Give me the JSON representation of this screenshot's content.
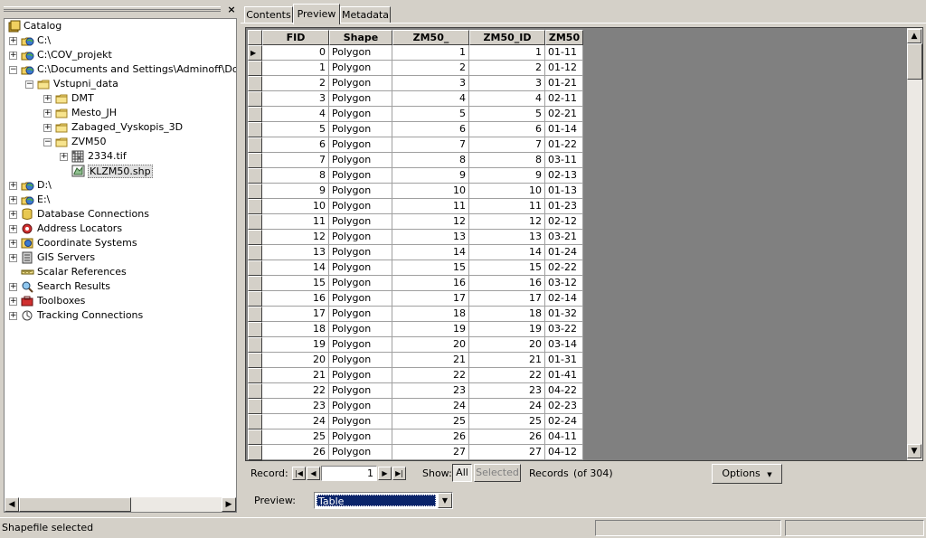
{
  "catalog": {
    "close_glyph": "×",
    "nodes": [
      {
        "label": "Catalog",
        "icon": "catalog-icon",
        "level": 0,
        "expander": ""
      },
      {
        "label": "C:\\",
        "icon": "folder-connection-icon",
        "level": 1,
        "expander": "+"
      },
      {
        "label": "C:\\COV_projekt",
        "icon": "folder-connection-icon",
        "level": 1,
        "expander": "+"
      },
      {
        "label": "C:\\Documents and Settings\\Adminoff\\Dokum",
        "icon": "folder-connection-icon",
        "level": 1,
        "expander": "−"
      },
      {
        "label": "Vstupni_data",
        "icon": "folder-icon",
        "level": 2,
        "expander": "−"
      },
      {
        "label": "DMT",
        "icon": "folder-icon",
        "level": 3,
        "expander": "+"
      },
      {
        "label": "Mesto_JH",
        "icon": "folder-icon",
        "level": 3,
        "expander": "+"
      },
      {
        "label": "Zabaged_Vyskopis_3D",
        "icon": "folder-icon",
        "level": 3,
        "expander": "+"
      },
      {
        "label": "ZVM50",
        "icon": "folder-icon",
        "level": 3,
        "expander": "−"
      },
      {
        "label": "2334.tif",
        "icon": "raster-icon",
        "level": 4,
        "expander": "+"
      },
      {
        "label": "KLZM50.shp",
        "icon": "shapefile-icon",
        "level": 4,
        "expander": "",
        "selected": true
      },
      {
        "label": "D:\\",
        "icon": "folder-connection-icon",
        "level": 1,
        "expander": "+"
      },
      {
        "label": "E:\\",
        "icon": "folder-connection-icon",
        "level": 1,
        "expander": "+"
      },
      {
        "label": "Database Connections",
        "icon": "database-connections-icon",
        "level": 1,
        "expander": "+"
      },
      {
        "label": "Address Locators",
        "icon": "address-locators-icon",
        "level": 1,
        "expander": "+"
      },
      {
        "label": "Coordinate Systems",
        "icon": "coordinate-systems-icon",
        "level": 1,
        "expander": "+"
      },
      {
        "label": "GIS Servers",
        "icon": "gis-servers-icon",
        "level": 1,
        "expander": "+"
      },
      {
        "label": "Scalar References",
        "icon": "scalar-references-icon",
        "level": 1,
        "expander": ""
      },
      {
        "label": "Search Results",
        "icon": "search-results-icon",
        "level": 1,
        "expander": "+"
      },
      {
        "label": "Toolboxes",
        "icon": "toolboxes-icon",
        "level": 1,
        "expander": "+"
      },
      {
        "label": "Tracking Connections",
        "icon": "tracking-connections-icon",
        "level": 1,
        "expander": "+"
      }
    ]
  },
  "tabs": [
    "Contents",
    "Preview",
    "Metadata"
  ],
  "active_tab": 1,
  "table": {
    "columns": [
      "FID",
      "Shape",
      "ZM50_",
      "ZM50_ID",
      "ZM50"
    ],
    "rows": [
      [
        "0",
        "Polygon",
        "1",
        "1",
        "01-11"
      ],
      [
        "1",
        "Polygon",
        "2",
        "2",
        "01-12"
      ],
      [
        "2",
        "Polygon",
        "3",
        "3",
        "01-21"
      ],
      [
        "3",
        "Polygon",
        "4",
        "4",
        "02-11"
      ],
      [
        "4",
        "Polygon",
        "5",
        "5",
        "02-21"
      ],
      [
        "5",
        "Polygon",
        "6",
        "6",
        "01-14"
      ],
      [
        "6",
        "Polygon",
        "7",
        "7",
        "01-22"
      ],
      [
        "7",
        "Polygon",
        "8",
        "8",
        "03-11"
      ],
      [
        "8",
        "Polygon",
        "9",
        "9",
        "02-13"
      ],
      [
        "9",
        "Polygon",
        "10",
        "10",
        "01-13"
      ],
      [
        "10",
        "Polygon",
        "11",
        "11",
        "01-23"
      ],
      [
        "11",
        "Polygon",
        "12",
        "12",
        "02-12"
      ],
      [
        "12",
        "Polygon",
        "13",
        "13",
        "03-21"
      ],
      [
        "13",
        "Polygon",
        "14",
        "14",
        "01-24"
      ],
      [
        "14",
        "Polygon",
        "15",
        "15",
        "02-22"
      ],
      [
        "15",
        "Polygon",
        "16",
        "16",
        "03-12"
      ],
      [
        "16",
        "Polygon",
        "17",
        "17",
        "02-14"
      ],
      [
        "17",
        "Polygon",
        "18",
        "18",
        "01-32"
      ],
      [
        "18",
        "Polygon",
        "19",
        "19",
        "03-22"
      ],
      [
        "19",
        "Polygon",
        "20",
        "20",
        "03-14"
      ],
      [
        "20",
        "Polygon",
        "21",
        "21",
        "01-31"
      ],
      [
        "21",
        "Polygon",
        "22",
        "22",
        "01-41"
      ],
      [
        "22",
        "Polygon",
        "23",
        "23",
        "04-22"
      ],
      [
        "23",
        "Polygon",
        "24",
        "24",
        "02-23"
      ],
      [
        "24",
        "Polygon",
        "25",
        "25",
        "02-24"
      ],
      [
        "25",
        "Polygon",
        "26",
        "26",
        "04-11"
      ],
      [
        "26",
        "Polygon",
        "27",
        "27",
        "04-12"
      ]
    ],
    "current_row_marker": "▶"
  },
  "record_bar": {
    "record_label": "Record:",
    "current_record": "1",
    "show_label": "Show:",
    "all_label": "All",
    "selected_label": "Selected",
    "records_label": "Records",
    "records_count": "(of 304)",
    "options_label": "Options"
  },
  "preview": {
    "label": "Preview:",
    "selected_value": "Table"
  },
  "status_bar": {
    "text": "Shapefile selected"
  },
  "glyphs": {
    "first": "|◀",
    "prev": "◀",
    "next": "▶",
    "last": "▶|",
    "dropdown": "▼",
    "scroll_up": "▲",
    "scroll_down": "▼",
    "scroll_left": "◀",
    "scroll_right": "▶"
  }
}
